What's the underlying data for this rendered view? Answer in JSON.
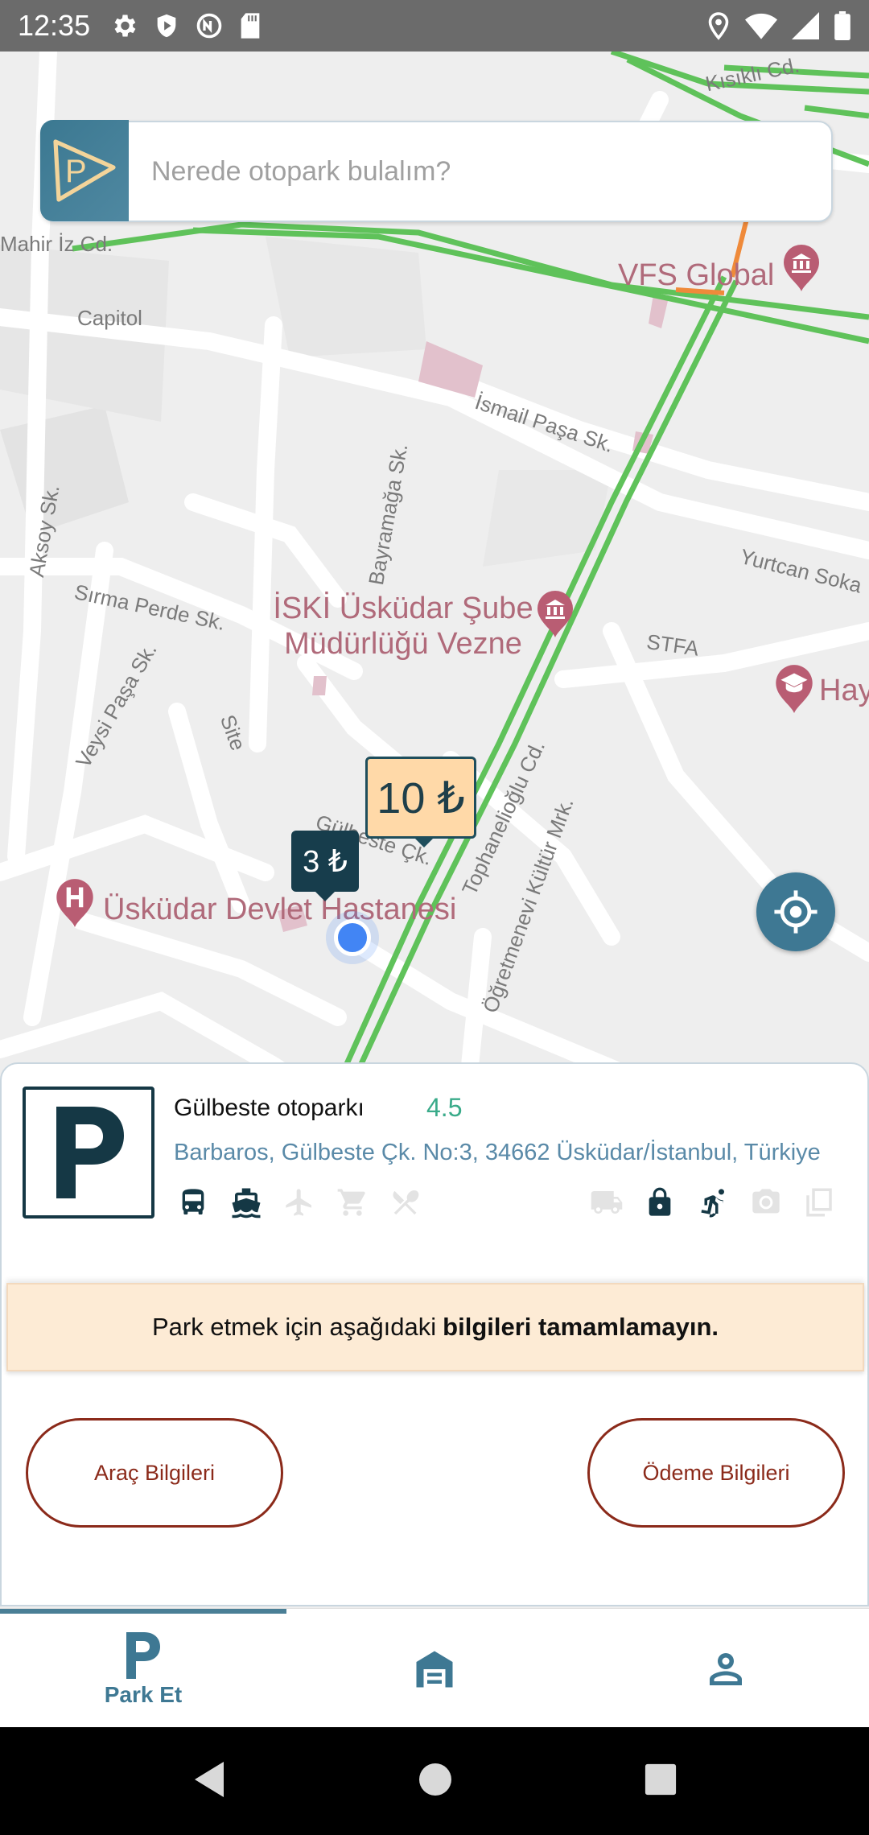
{
  "status_bar": {
    "time": "12:35"
  },
  "search": {
    "placeholder": "Nerede otopark bulalım?"
  },
  "map": {
    "streets": [
      "Kısıklı Cd.",
      "Mahir İz Cd.",
      "Capitol",
      "İsmail Paşa Sk.",
      "Aksoy Sk.",
      "Bayramağa Sk.",
      "Yurtcan Soka",
      "Sırma Perde Sk.",
      "STFA",
      "Site",
      "Veysi Paşa Sk.",
      "Gülbeste Çk.",
      "Tophanelioğlu Cd.",
      "Öğretmenevi Kültür Mrk.",
      "Lı Cd."
    ],
    "pois": {
      "vfs": "VFS Global",
      "iski": "İSKİ Üsküdar Şube Müdürlüğü Vezne",
      "hay": "Hay",
      "hospital": "Üsküdar Devlet Hastanesi"
    },
    "markers": {
      "big_price": "10 ₺",
      "small_price": "3 ₺"
    },
    "colors": {
      "traffic_green": "#5fc25a",
      "traffic_orange": "#ef8a3a"
    }
  },
  "parking": {
    "name": "Gülbeste otoparkı",
    "rating": "4.5",
    "address": "Barbaros, Gülbeste Çk. No:3, 34662 Üsküdar/İstanbul, Türkiye",
    "amenities": [
      {
        "icon": "bus-icon",
        "active": true
      },
      {
        "icon": "ferry-icon",
        "active": true
      },
      {
        "icon": "airplane-icon",
        "active": false
      },
      {
        "icon": "cart-icon",
        "active": false
      },
      {
        "icon": "restaurant-icon",
        "active": false
      },
      {
        "icon": "truck-icon",
        "active": false
      },
      {
        "icon": "lock-icon",
        "active": true
      },
      {
        "icon": "accessible-icon",
        "active": true
      },
      {
        "icon": "camera-icon",
        "active": false
      },
      {
        "icon": "copy-icon",
        "active": false
      }
    ]
  },
  "notice": {
    "text_normal": "Park etmek için aşağıdaki",
    "text_bold": "bilgileri tamamlamayın."
  },
  "buttons": {
    "vehicle": "Araç Bilgileri",
    "payment": "Ödeme Bilgileri"
  },
  "nav": {
    "park_label": "Park Et"
  }
}
